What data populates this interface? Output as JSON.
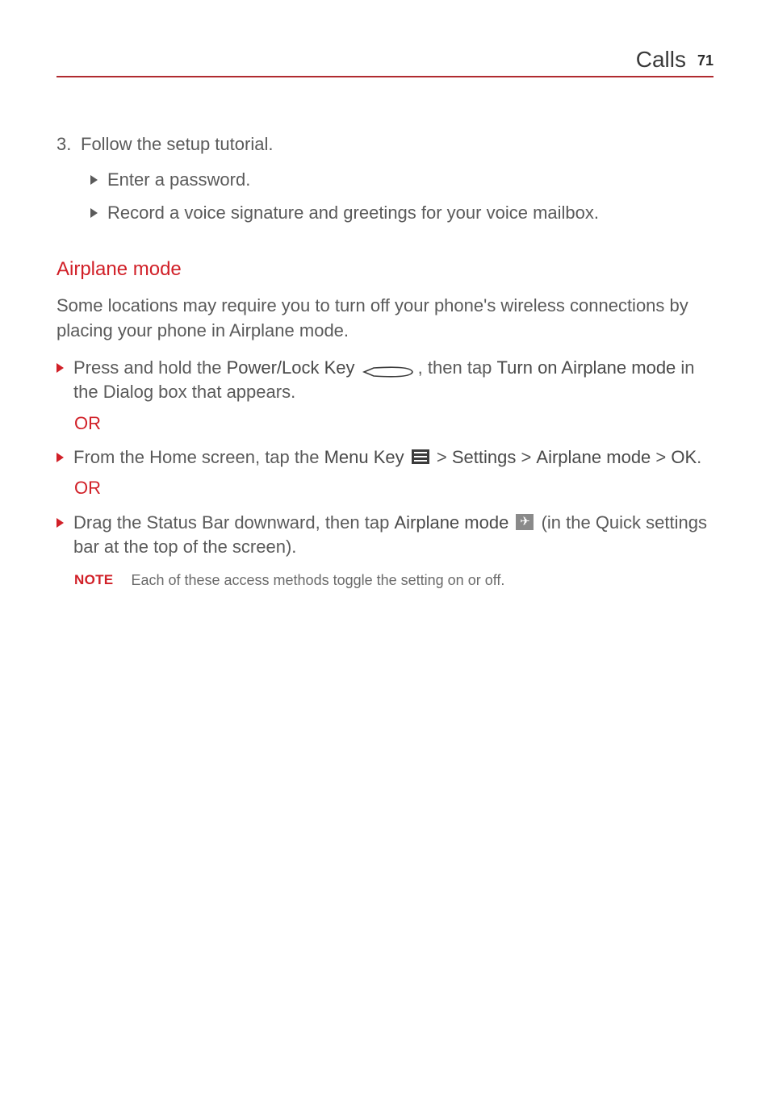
{
  "header": {
    "section": "Calls",
    "page_number": "71"
  },
  "step3": {
    "number": "3.",
    "text": "Follow the setup tutorial.",
    "subs": [
      "Enter a password.",
      "Record a voice signature and greetings for your voice mailbox."
    ]
  },
  "airplane": {
    "heading": "Airplane mode",
    "intro": "Some locations may require you to turn off your phone's wireless connections by placing your phone in Airplane mode.",
    "m1": {
      "pre": "Press and hold the ",
      "k1": "Power/Lock Key",
      "mid": ", then tap ",
      "k2": "Turn on Airplane mode",
      "post": " in the Dialog box that appears."
    },
    "or": "OR",
    "m2": {
      "pre": "From the Home screen, tap the ",
      "k1": "Menu Key",
      "gt1": " > ",
      "k2": "Settings",
      "gt2": " > ",
      "k3": "Airplane mode",
      "gt3": " > ",
      "k4": "OK",
      "post": "."
    },
    "m3": {
      "pre": "Drag the Status Bar downward, then tap ",
      "k1": "Airplane mode",
      "post": " (in the Quick settings bar at the top of the screen)."
    },
    "note": {
      "label": "NOTE",
      "text": "Each of these access methods toggle the setting on or off."
    }
  },
  "icons": {
    "power": "power-lock-key-icon",
    "menu": "menu-key-icon",
    "plane": "airplane-mode-icon"
  }
}
